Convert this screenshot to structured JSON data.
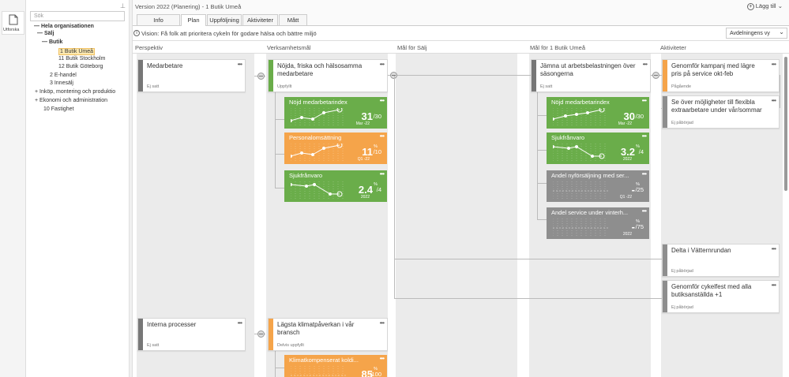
{
  "left_panel": {
    "label": "Utforska"
  },
  "tree": {
    "search_placeholder": "Sök",
    "items": [
      {
        "label": "Hela organisationen",
        "prefix": "—"
      },
      {
        "label": "Sälj",
        "prefix": "—"
      },
      {
        "label": "Butik",
        "prefix": "—"
      },
      {
        "label": "1 Butik Umeå",
        "prefix": ""
      },
      {
        "label": "11 Butik Stockholm",
        "prefix": ""
      },
      {
        "label": "12 Butik Göteborg",
        "prefix": ""
      },
      {
        "label": "2 E-handel",
        "prefix": ""
      },
      {
        "label": "3 Innesälj",
        "prefix": ""
      },
      {
        "label": "Inköp, montering och produktio",
        "prefix": "+"
      },
      {
        "label": "Ekonomi och administration",
        "prefix": "+"
      },
      {
        "label": "10 Fastighet",
        "prefix": ""
      }
    ]
  },
  "header": {
    "title": "Version 2022 (Planering) - 1 Butik Umeå",
    "add_label": "Lägg till"
  },
  "tabs": [
    "Info",
    "Plan",
    "Uppföljning",
    "Aktiviteter",
    "Mått"
  ],
  "vision": {
    "text": "Vision: Få folk att prioritera cykeln för godare hälsa och bättre miljö",
    "view_select": "Avdelningens vy"
  },
  "columns": [
    "Perspektiv",
    "Verksamhetsmål",
    "Mål för Sälj",
    "Mål för 1 Butik Umeå",
    "Aktiviteter"
  ],
  "perspectives": [
    {
      "title": "Medarbetare",
      "status": "Ej satt"
    },
    {
      "title": "Interna processer",
      "status": "Ej satt"
    }
  ],
  "goals": [
    {
      "title": "Nöjda, friska och hälsosamma medarbetare",
      "status": "Uppfyllt",
      "color": "#6aad4a"
    },
    {
      "title": "Lägsta klimatpåverkan i vår bransch",
      "status": "Delvis uppfyllt",
      "color": "#f5a44a"
    }
  ],
  "goal_kpis": [
    {
      "title": "Nöjd medarbetarindex",
      "value": "31",
      "target": "/30",
      "unit": "",
      "period": "Mar -22",
      "color": "#6aad4a"
    },
    {
      "title": "Personalomsättning",
      "value": "11",
      "target": "/10",
      "unit": "%",
      "period": "Q1 -22",
      "color": "#f5a44a"
    },
    {
      "title": "Sjukfrånvaro",
      "value": "2.4",
      "target": "/4",
      "unit": "%",
      "period": "2022",
      "color": "#6aad4a"
    },
    {
      "title": "Klimatkompenserat koldi...",
      "value": "85",
      "target": "/100",
      "unit": "%",
      "period": "",
      "color": "#f5a44a"
    }
  ],
  "store_goal": {
    "title": "Jämna ut arbetsbelastningen över säsongerna",
    "status": "Ej satt"
  },
  "store_kpis": [
    {
      "title": "Nöjd medarbetarindex",
      "value": "30",
      "target": "/30",
      "unit": "",
      "period": "Mar -22",
      "color": "#6aad4a"
    },
    {
      "title": "Sjukfrånvaro",
      "value": "3.2",
      "target": "/4",
      "unit": "%",
      "period": "2022",
      "color": "#6aad4a"
    },
    {
      "title": "Andel nyförsäljning med ser...",
      "value": "-",
      "target": "/25",
      "unit": "%",
      "period": "Q1 -22",
      "color": "#8e8e8e"
    },
    {
      "title": "Andel service under vinterh...",
      "value": "-",
      "target": "/75",
      "unit": "%",
      "period": "2022",
      "color": "#8e8e8e"
    }
  ],
  "activities": [
    {
      "title": "Genomför kampanj med lägre pris på service okt-feb",
      "status": "Pågående",
      "color": "#f5a44a"
    },
    {
      "title": "Se över möjligheter till flexibla extraarbetare under vår/sommar",
      "status": "Ej påbörjad",
      "color": "#8e8e8e"
    },
    {
      "title": "Delta i Vätternrundan",
      "status": "Ej påbörjad",
      "color": "#8e8e8e"
    },
    {
      "title": "Genomför cykelfest med alla butiksanställda +1",
      "status": "Ej påbörjad",
      "color": "#8e8e8e"
    }
  ]
}
